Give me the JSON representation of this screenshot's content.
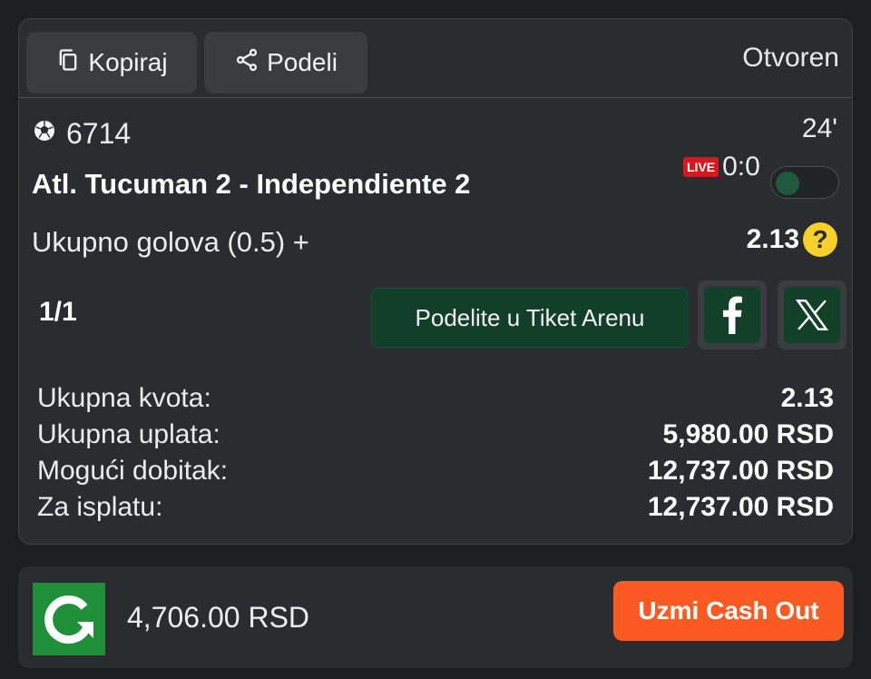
{
  "ticket": {
    "copy_label": "Kopiraj",
    "share_label": "Podeli",
    "status": "Otvoren"
  },
  "event": {
    "sport_icon": "soccer-ball-icon",
    "id": "6714",
    "minute": "24'",
    "match": "Atl. Tucuman 2 - Independiente 2",
    "live_badge": "LIVE",
    "score": "0:0",
    "market": "Ukupno golova (0.5) +",
    "odd": "2.13",
    "help_glyph": "?"
  },
  "pagination": "1/1",
  "share_arena_label": "Podelite u Tiket Arenu",
  "summary": [
    {
      "label": "Ukupna kvota:",
      "value": "2.13"
    },
    {
      "label": "Ukupna uplata:",
      "value": "5,980.00 RSD"
    },
    {
      "label": "Mogući dobitak:",
      "value": "12,737.00 RSD"
    },
    {
      "label": "Za isplatu:",
      "value": "12,737.00 RSD"
    }
  ],
  "cashout": {
    "amount": "4,706.00 RSD",
    "button_label": "Uzmi Cash Out"
  },
  "colors": {
    "accent_orange": "#fb5a22",
    "arena_green": "#123f2a",
    "live_red": "#d7191f",
    "help_yellow": "#f5d12a"
  }
}
